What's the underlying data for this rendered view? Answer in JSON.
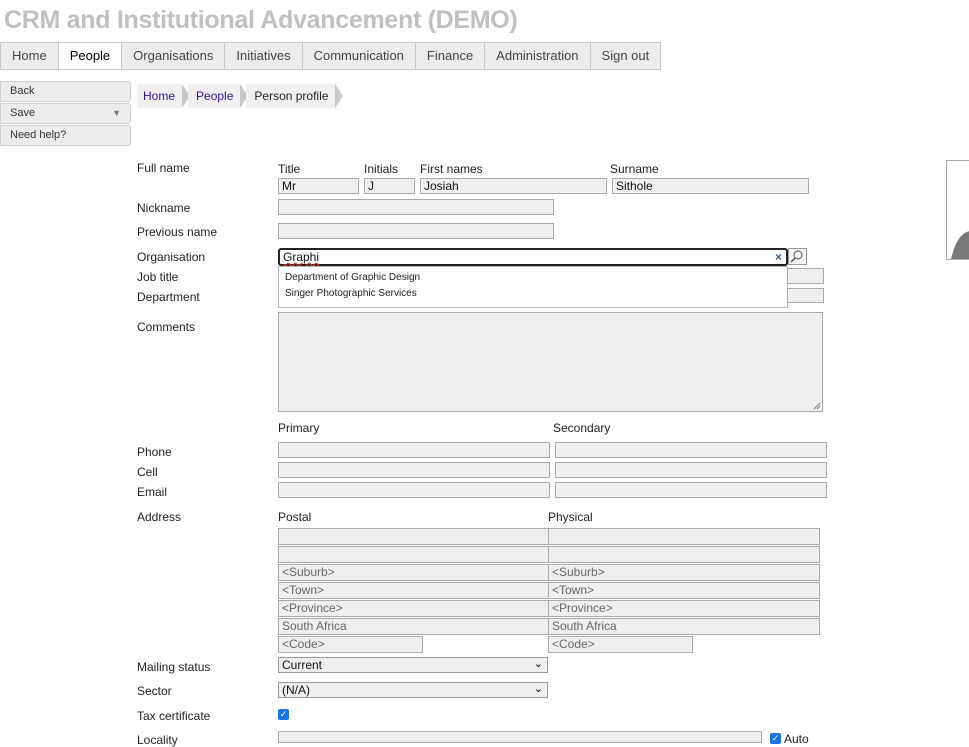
{
  "app_title": "CRM and Institutional Advancement (DEMO)",
  "nav": {
    "tabs": [
      "Home",
      "People",
      "Organisations",
      "Initiatives",
      "Communication",
      "Finance",
      "Administration",
      "Sign out"
    ],
    "active": "People"
  },
  "sidebar": {
    "back": "Back",
    "save": "Save",
    "help": "Need help?"
  },
  "breadcrumb": [
    "Home",
    "People",
    "Person profile"
  ],
  "form": {
    "labels": {
      "full_name": "Full name",
      "nickname": "Nickname",
      "previous_name": "Previous name",
      "organisation": "Organisation",
      "job_title": "Job title",
      "department": "Department",
      "comments": "Comments",
      "phone": "Phone",
      "cell": "Cell",
      "email": "Email",
      "address": "Address",
      "mailing_status": "Mailing status",
      "sector": "Sector",
      "tax_certificate": "Tax certificate",
      "locality": "Locality"
    },
    "name_headers": {
      "title": "Title",
      "initials": "Initials",
      "first_names": "First names",
      "surname": "Surname"
    },
    "name_values": {
      "title": "Mr",
      "initials": "J",
      "first_names": "Josiah",
      "surname": "Sithole"
    },
    "organisation_search": "Graphi",
    "organisation_suggestions": [
      "Department of Graphic Design",
      "Singer Photographic Services"
    ],
    "contact_headers": {
      "primary": "Primary",
      "secondary": "Secondary"
    },
    "address_headers": {
      "postal": "Postal",
      "physical": "Physical"
    },
    "address_placeholders": {
      "suburb": "<Suburb>",
      "town": "<Town>",
      "province": "<Province>",
      "code": "<Code>"
    },
    "country": "South Africa",
    "mailing_status_value": "Current",
    "sector_value": "(N/A)",
    "tax_certificate_checked": true,
    "locality_auto_label": "Auto"
  }
}
